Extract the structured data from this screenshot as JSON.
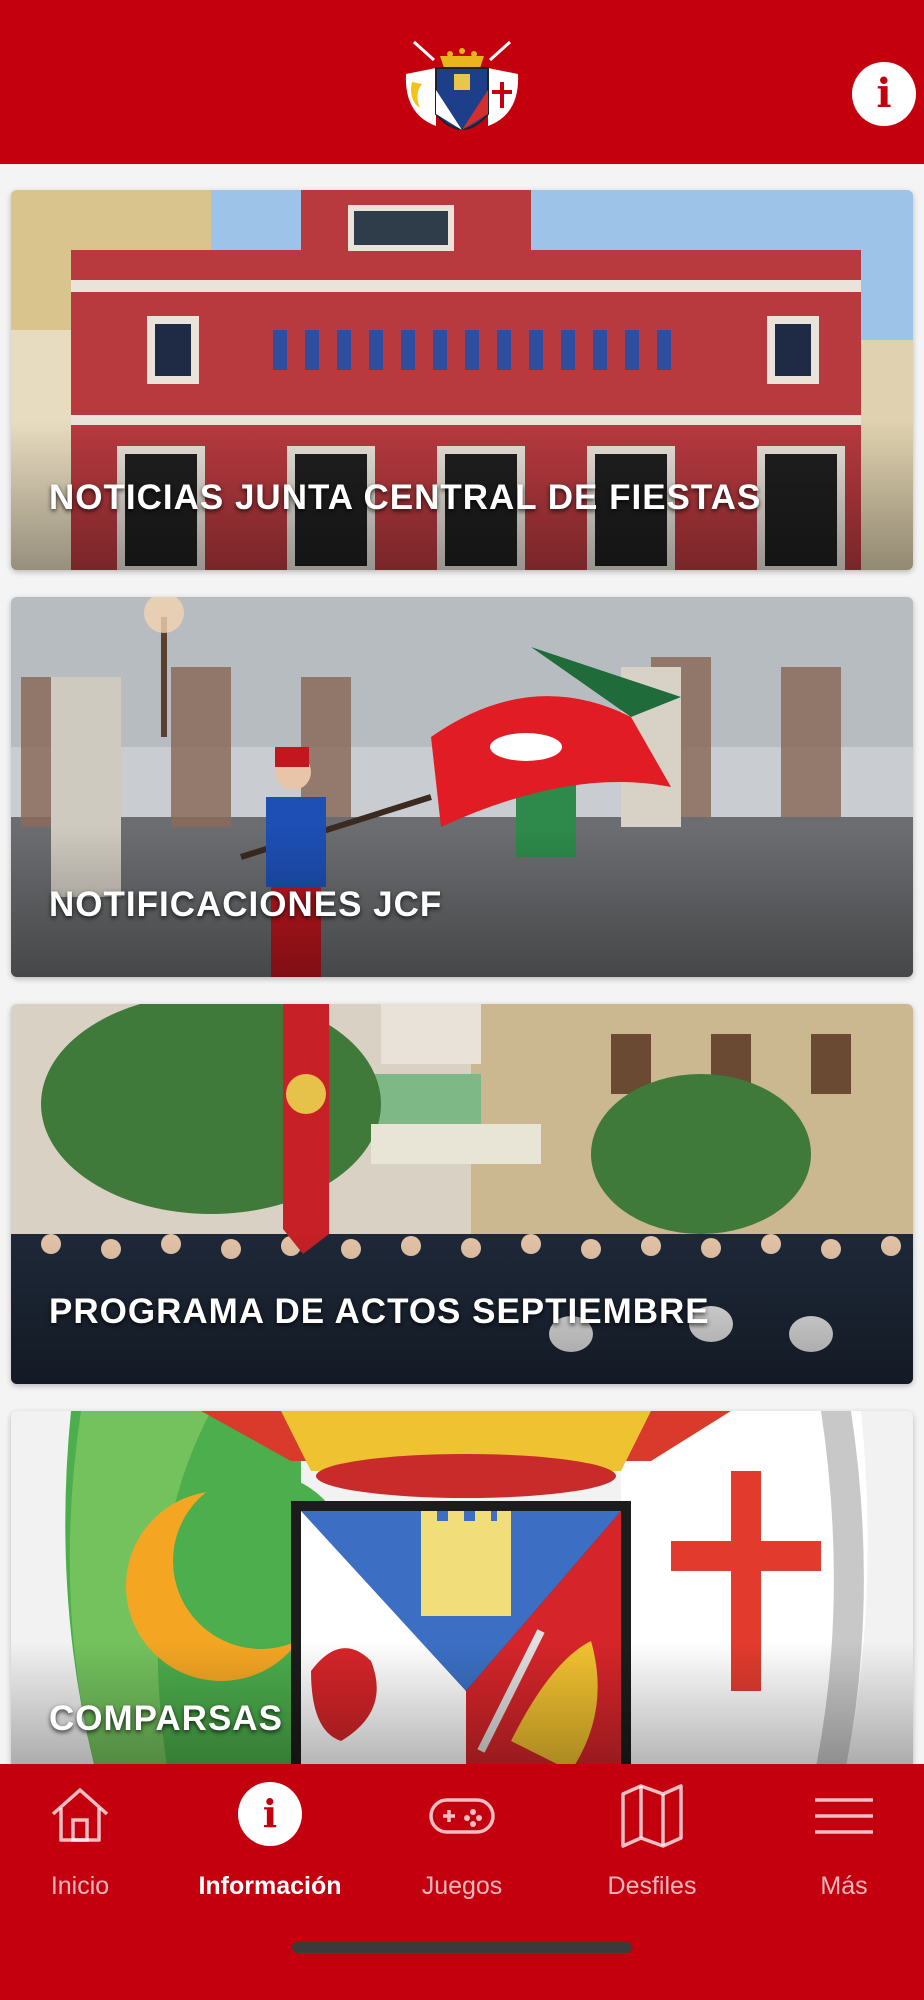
{
  "header": {
    "info_glyph": "i",
    "logo_icon": "coat-of-arms-logo",
    "background": "#c4000f"
  },
  "cards": [
    {
      "label": "NOTICIAS JUNTA CENTRAL DE FIESTAS",
      "image": "red-town-hall-building"
    },
    {
      "label": "NOTIFICACIONES JCF",
      "image": "parade-with-red-flag"
    },
    {
      "label": "PROGRAMA DE ACTOS SEPTIEMBRE",
      "image": "marching-band-street"
    },
    {
      "label": "COMPARSAS",
      "image": "coat-of-arms-crescent-cross"
    }
  ],
  "tabbar": {
    "active": "Información",
    "tabs": [
      {
        "label": "Inicio",
        "icon": "home-icon"
      },
      {
        "label": "Información",
        "icon": "info-icon",
        "glyph": "i"
      },
      {
        "label": "Juegos",
        "icon": "gamepad-icon"
      },
      {
        "label": "Desfiles",
        "icon": "map-icon"
      },
      {
        "label": "Más",
        "icon": "menu-icon"
      }
    ]
  },
  "colors": {
    "brand_red": "#c4000f",
    "white": "#ffffff"
  }
}
